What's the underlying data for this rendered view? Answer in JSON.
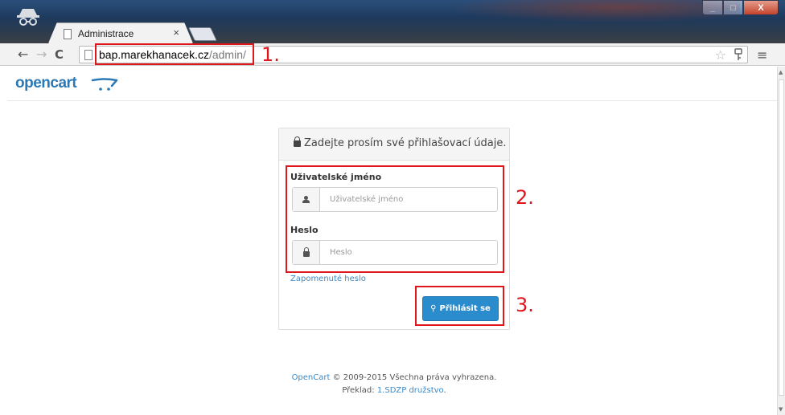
{
  "browser": {
    "tab_title": "Administrace",
    "tab_close": "×",
    "url_host": "bap.marekhanacek.cz",
    "url_path": "/admin/",
    "back": "←",
    "forward": "→",
    "reload": "C",
    "star": "☆",
    "menu": "≡",
    "window_controls": {
      "minimize": "_",
      "maximize": "□",
      "close": "X"
    }
  },
  "header": {
    "logo": "opencart"
  },
  "login_panel": {
    "heading": "Zadejte prosím své přihlašovací údaje.",
    "username_label": "Uživatelské jméno",
    "username_placeholder": "Uživatelské jméno",
    "password_label": "Heslo",
    "password_placeholder": "Heslo",
    "forgot_link": "Zapomenuté heslo",
    "login_button": "Přihlásit se"
  },
  "footer": {
    "brand_link": "OpenCart",
    "copyright": "© 2009-2015 Všechna práva vyhrazena.",
    "translation_prefix": "Překlad:",
    "translation_link": "1.SDZP družstvo",
    "translation_suffix": "."
  },
  "annotations": {
    "step1": "1.",
    "step2": "2.",
    "step3": "3."
  },
  "colors": {
    "accent": "#2a8ccc",
    "annotation": "#e0161d",
    "logo": "#2c79b5",
    "link": "#3a8ac9"
  },
  "icons": [
    "incognito-icon",
    "document-icon",
    "lock-icon",
    "user-icon",
    "key-icon",
    "star-icon",
    "menu-icon",
    "cart-icon"
  ]
}
